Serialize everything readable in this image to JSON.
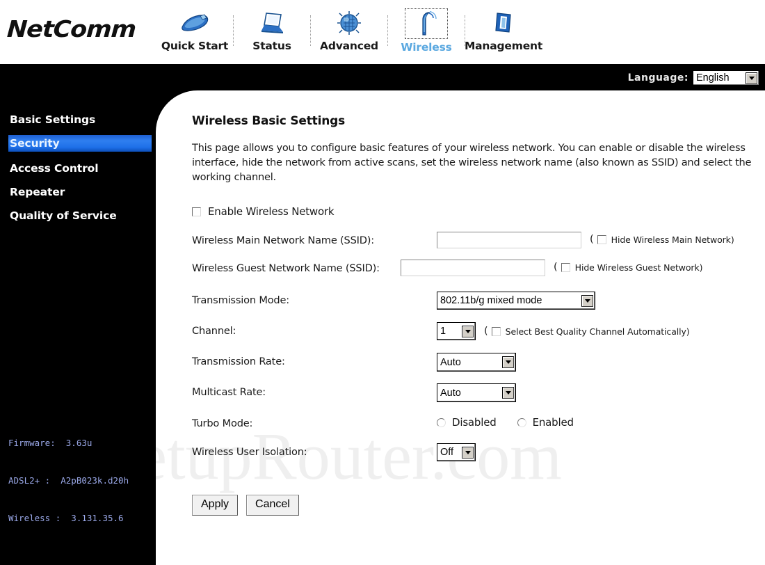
{
  "brand": {
    "logo_text": "NetComm"
  },
  "nav": {
    "items": [
      {
        "label": "Quick Start",
        "icon": "mouse-icon",
        "focused": false
      },
      {
        "label": "Status",
        "icon": "laptop-icon",
        "focused": false
      },
      {
        "label": "Advanced",
        "icon": "chip-icon",
        "focused": false
      },
      {
        "label": "Wireless",
        "icon": "antenna-icon",
        "focused": true
      },
      {
        "label": "Management",
        "icon": "book-icon",
        "focused": false
      }
    ]
  },
  "language": {
    "label": "Language:",
    "value": "English",
    "options": [
      "English"
    ]
  },
  "sidebar": {
    "items": [
      {
        "label": "Basic Settings",
        "active": false
      },
      {
        "label": "Security",
        "active": true
      },
      {
        "label": "Access Control",
        "active": false
      },
      {
        "label": "Repeater",
        "active": false
      },
      {
        "label": "Quality of Service",
        "active": false
      }
    ],
    "firmware": {
      "line1": "Firmware:  3.63u",
      "line2": "ADSL2+ :  A2pB023k.d20h",
      "line3": "Wireless :  3.131.35.6"
    }
  },
  "watermark": {
    "text": "SetupRouter.com"
  },
  "main": {
    "title": "Wireless Basic Settings",
    "description": "This page allows you to configure basic features of your wireless network. You can enable or disable the wireless interface, hide the network from active scans, set the wireless network name (also known as SSID) and select the working channel.",
    "enable_wireless": {
      "label": "Enable Wireless Network",
      "checked": false
    },
    "ssid_main": {
      "label": "Wireless Main Network Name (SSID):",
      "value": "",
      "placeholder": "",
      "hide_label": "Hide Wireless Main Network)",
      "hide_checked": false,
      "paren_open": "("
    },
    "ssid_guest": {
      "label": "Wireless Guest Network Name (SSID):",
      "value": "",
      "placeholder": "",
      "hide_label": "Hide Wireless Guest Network)",
      "hide_checked": false,
      "paren_open": "("
    },
    "transmission_mode": {
      "label": "Transmission Mode:",
      "value": "802.11b/g mixed mode",
      "options": [
        "802.11b/g mixed mode"
      ]
    },
    "channel": {
      "label": "Channel:",
      "value": "1",
      "options": [
        "1"
      ],
      "auto_label": "Select Best Quality Channel Automatically)",
      "auto_checked": false,
      "paren_open": "("
    },
    "transmission_rate": {
      "label": "Transmission Rate:",
      "value": "Auto",
      "options": [
        "Auto"
      ]
    },
    "multicast_rate": {
      "label": "Multicast Rate:",
      "value": "Auto",
      "options": [
        "Auto"
      ]
    },
    "turbo_mode": {
      "label": "Turbo Mode:",
      "option_disabled": "Disabled",
      "option_enabled": "Enabled",
      "selected": ""
    },
    "user_isolation": {
      "label": "Wireless User Isolation:",
      "value": "Off",
      "options": [
        "Off"
      ]
    },
    "buttons": {
      "apply": "Apply",
      "cancel": "Cancel"
    }
  },
  "colors": {
    "accent_blue": "#2f7ff0",
    "nav_active": "#5aa8e0",
    "firmware_text": "#9aa8e8",
    "background_black": "#000000",
    "panel_white": "#ffffff"
  }
}
